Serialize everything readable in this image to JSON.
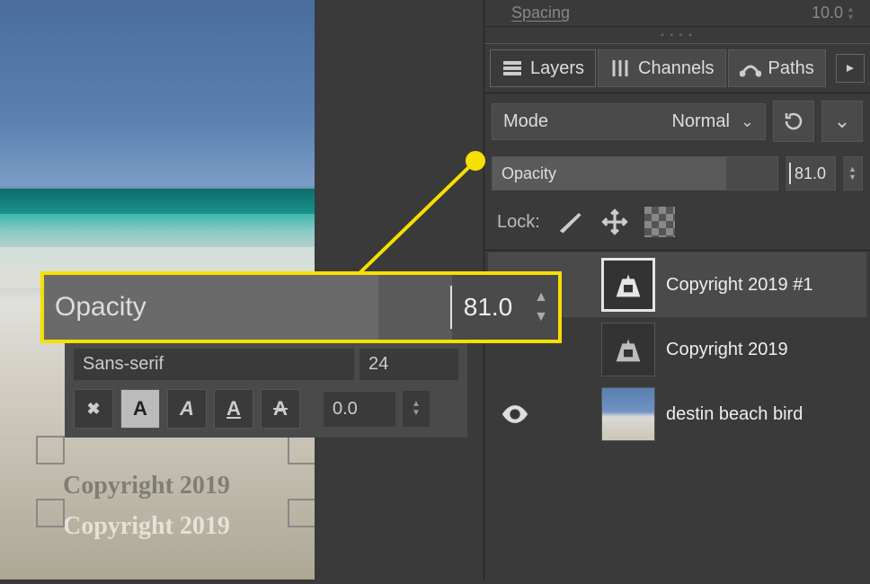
{
  "canvas": {
    "text1": "Copyright 2019",
    "text2": "Copyright 2019"
  },
  "text_tool": {
    "font": "Sans-serif",
    "size": "24",
    "baseline": "0.0"
  },
  "callout": {
    "label": "Opacity",
    "value": "81.0"
  },
  "spacing": {
    "label": "Spacing",
    "value": "10.0"
  },
  "dock": {
    "tabs": {
      "layers": "Layers",
      "channels": "Channels",
      "paths": "Paths"
    }
  },
  "mode": {
    "label": "Mode",
    "value": "Normal"
  },
  "opacity": {
    "label": "Opacity",
    "value": "81.0"
  },
  "lock": {
    "label": "Lock:"
  },
  "layers": [
    {
      "name": "Copyright 2019 #1",
      "visible": true,
      "type": "text",
      "selected": true
    },
    {
      "name": "Copyright 2019",
      "visible": false,
      "type": "text",
      "selected": false
    },
    {
      "name": "destin beach bird",
      "visible": true,
      "type": "image",
      "selected": false
    }
  ]
}
